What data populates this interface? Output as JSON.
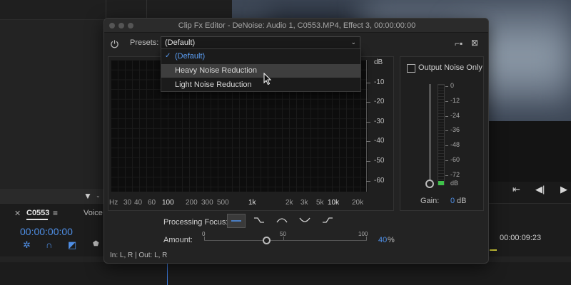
{
  "window": {
    "title": "Clip Fx Editor - DeNoise: Audio 1, C0553.MP4, Effect 3, 00:00:00:00"
  },
  "presets": {
    "label": "Presets:",
    "selected": "(Default)",
    "options": [
      "(Default)",
      "Heavy Noise Reduction",
      "Light Noise Reduction"
    ],
    "hovered": "Heavy Noise Reduction"
  },
  "graph": {
    "db_unit": "dB",
    "db_ticks": [
      "-10",
      "-20",
      "-30",
      "-40",
      "-50",
      "-60"
    ],
    "hz_unit": "Hz",
    "hz_ticks": [
      "30",
      "40",
      "60",
      "100",
      "200",
      "300",
      "500",
      "1k",
      "2k",
      "3k",
      "5k",
      "10k",
      "20k"
    ]
  },
  "output": {
    "checkbox_label": "Output Noise Only",
    "checked": false,
    "meter_ticks": [
      "0",
      "-12",
      "-24",
      "-36",
      "-48",
      "-60",
      "-72",
      "dB"
    ],
    "gain_label": "Gain:",
    "gain_value": "0",
    "gain_unit": "dB"
  },
  "processing": {
    "label": "Processing Focus:"
  },
  "amount": {
    "label": "Amount:",
    "scale": [
      "0",
      "50",
      "100"
    ],
    "value": "40",
    "unit": "%",
    "value_fraction": 0.4
  },
  "io": {
    "text": "In: L, R | Out: L, R"
  },
  "timeline": {
    "sequence_name": "C0553",
    "track_label": "Voice",
    "timecode": "00:00:00:00",
    "ruler_time": "00:00:09:23"
  },
  "colors": {
    "accent": "#4f8fe6",
    "meter_green": "#3fc14a",
    "timeline_marker": "#d8d23a"
  }
}
